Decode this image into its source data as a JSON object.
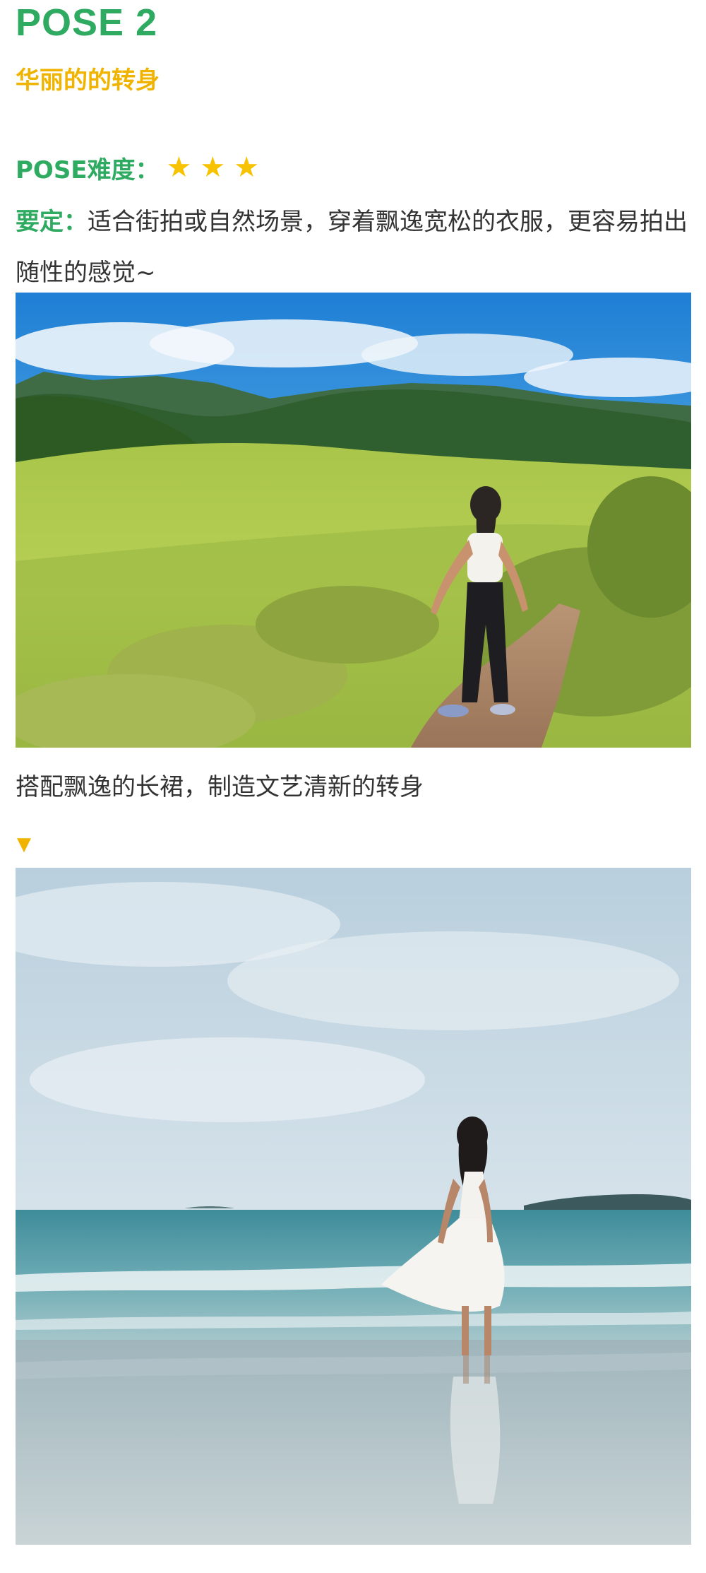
{
  "header": {
    "title": "POSE 2",
    "subtitle": "华丽的的转身"
  },
  "difficulty": {
    "label": "POSE难度：",
    "stars": [
      "★",
      "★",
      "★"
    ],
    "rating": 3
  },
  "key_points": {
    "label": "要定：",
    "text": "适合街拍或自然场景，穿着飘逸宽松的衣服，更容易拍出随性的感觉~"
  },
  "caption": "搭配飘逸的长裙，制造文艺清新的转身",
  "arrow": "▼",
  "colors": {
    "title_green": "#2eaa61",
    "accent_yellow": "#f0b400",
    "star_yellow": "#f7c300",
    "body_text": "#333333"
  }
}
